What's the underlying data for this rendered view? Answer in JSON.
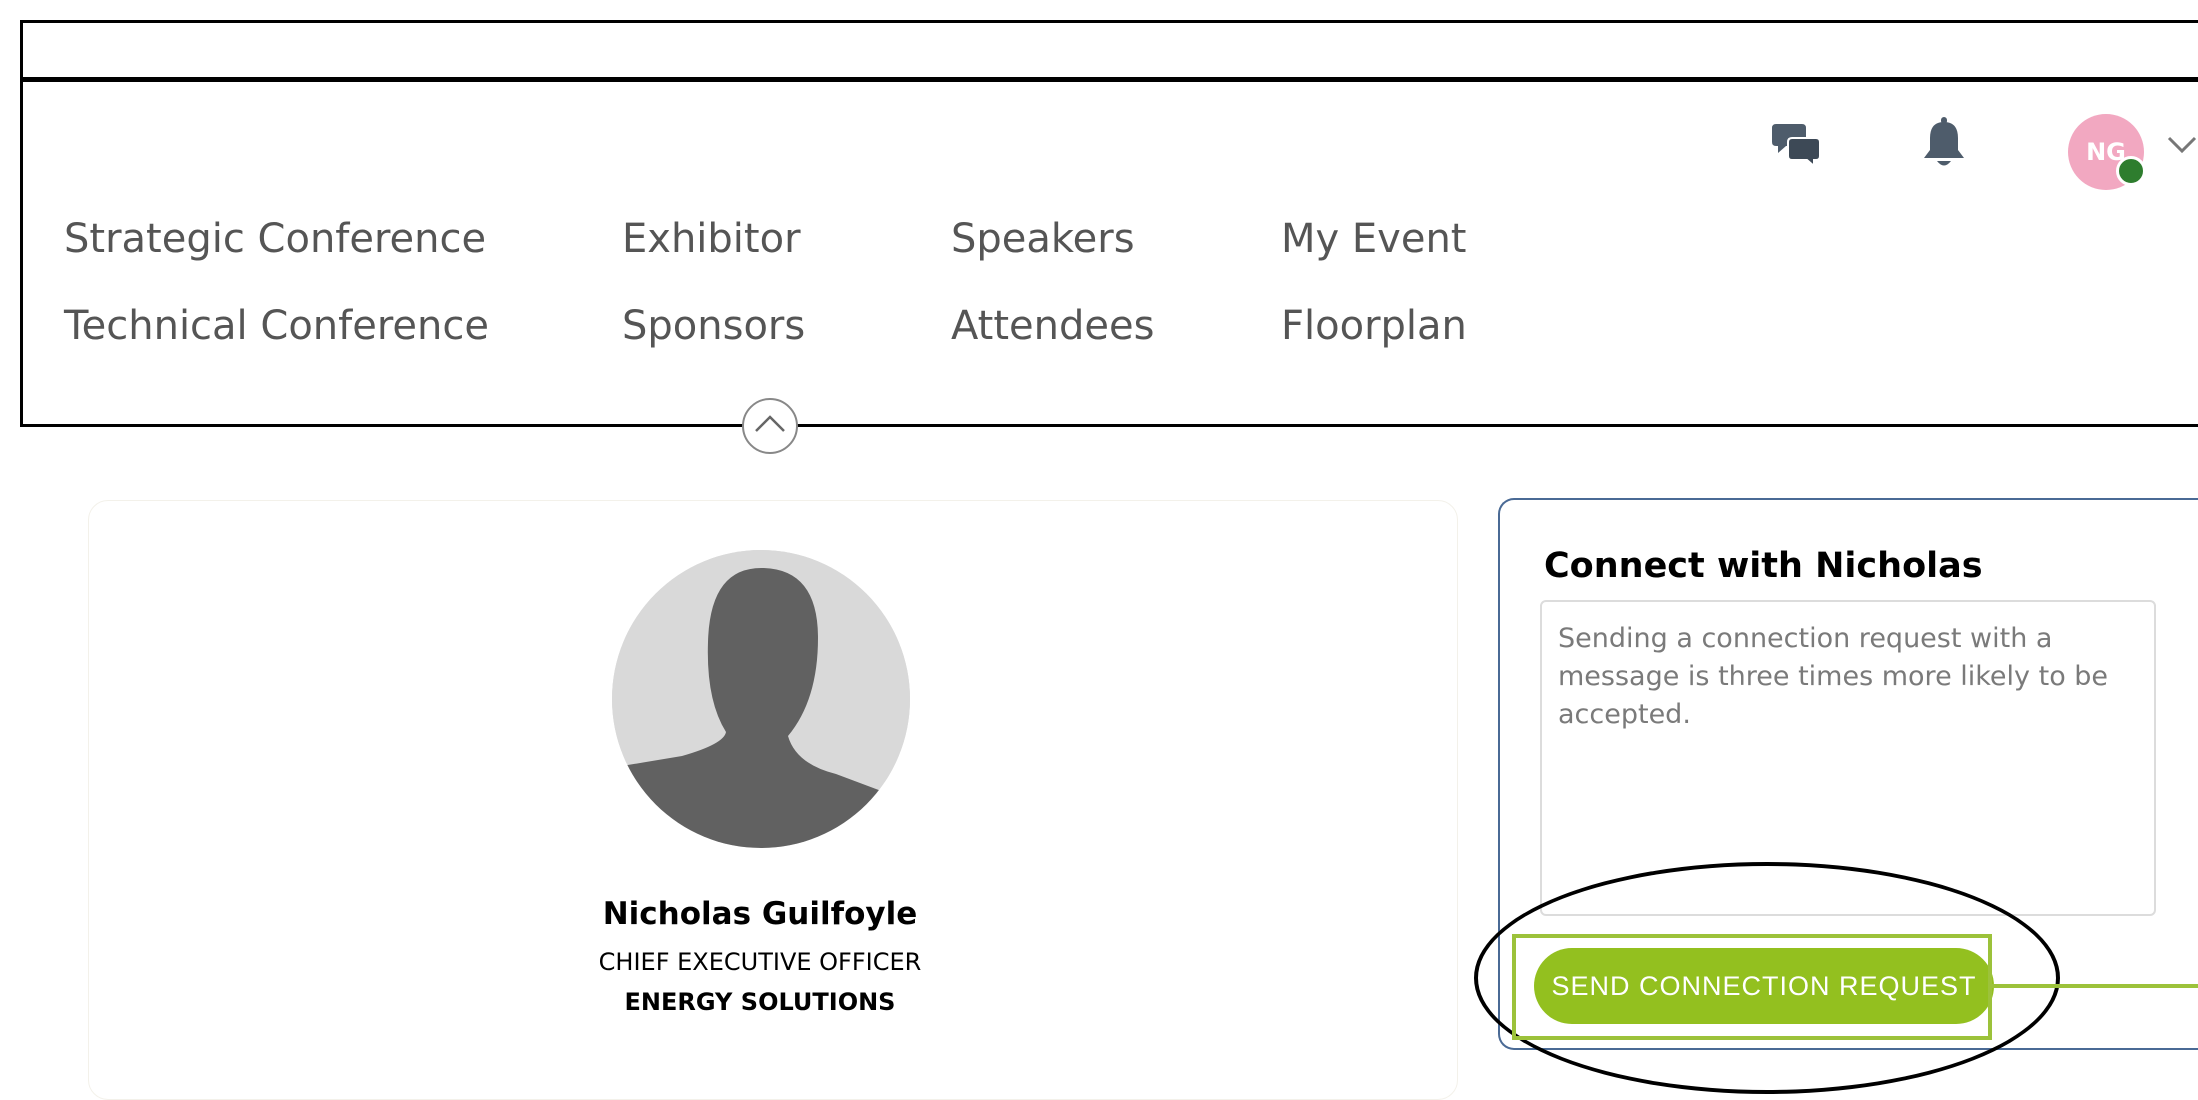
{
  "header": {
    "icons": [
      "chat-icon",
      "bell-icon",
      "chevron-down-icon",
      "chevron-up-icon"
    ],
    "user_initials": "NG",
    "presence_color": "#2e7d2e",
    "avatar_color": "#f2a8c1"
  },
  "nav": {
    "items": [
      "Strategic Conference",
      "Exhibitor",
      "Speakers",
      "My Event",
      "Technical Conference",
      "Sponsors",
      "Attendees",
      "Floorplan"
    ]
  },
  "profile": {
    "name": "Nicholas Guilfoyle",
    "title": "CHIEF EXECUTIVE OFFICER",
    "company": "ENERGY SOLUTIONS"
  },
  "connect": {
    "heading": "Connect with Nicholas",
    "message_value": "",
    "message_placeholder": "Sending a connection request with a message is three times more likely to be accepted.",
    "send_label": "SEND CONNECTION REQUEST",
    "accent_color": "#93c01f",
    "highlight_color": "#9cc23a"
  }
}
